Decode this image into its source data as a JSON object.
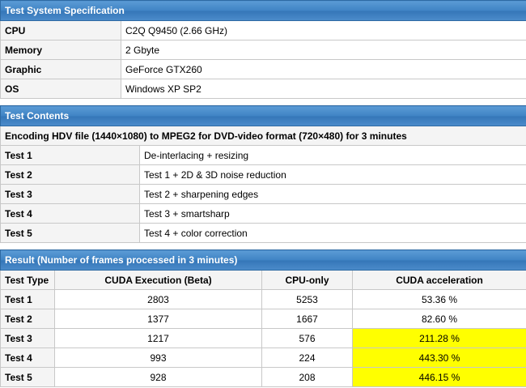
{
  "spec": {
    "title": "Test System Specification",
    "rows": [
      {
        "label": "CPU",
        "value": "C2Q Q9450 (2.66 GHz)"
      },
      {
        "label": "Memory",
        "value": "2 Gbyte"
      },
      {
        "label": "Graphic",
        "value": "GeForce GTX260"
      },
      {
        "label": "OS",
        "value": "Windows XP SP2"
      }
    ]
  },
  "contents": {
    "title": "Test Contents",
    "summary": "Encoding HDV file (1440×1080) to MPEG2 for DVD-video format (720×480) for 3 minutes",
    "rows": [
      {
        "label": "Test 1",
        "value": "De-interlacing + resizing"
      },
      {
        "label": "Test 2",
        "value": "Test 1 + 2D & 3D noise reduction"
      },
      {
        "label": "Test 3",
        "value": "Test 2 + sharpening edges"
      },
      {
        "label": "Test 4",
        "value": "Test 3 + smartsharp"
      },
      {
        "label": "Test 5",
        "value": "Test 4 + color correction"
      }
    ]
  },
  "result": {
    "title": "Result (Number of frames processed in 3 minutes)",
    "columns": [
      "Test Type",
      "CUDA Execution (Beta)",
      "CPU-only",
      "CUDA acceleration"
    ],
    "rows": [
      {
        "test": "Test 1",
        "cuda": "2803",
        "cpu": "5253",
        "accel": "53.36 %",
        "highlight": false
      },
      {
        "test": "Test 2",
        "cuda": "1377",
        "cpu": "1667",
        "accel": "82.60 %",
        "highlight": false
      },
      {
        "test": "Test 3",
        "cuda": "1217",
        "cpu": "576",
        "accel": "211.28 %",
        "highlight": true
      },
      {
        "test": "Test 4",
        "cuda": "993",
        "cpu": "224",
        "accel": "443.30 %",
        "highlight": true
      },
      {
        "test": "Test 5",
        "cuda": "928",
        "cpu": "208",
        "accel": "446.15 %",
        "highlight": true
      }
    ],
    "highlight_color": "#ffff00"
  }
}
